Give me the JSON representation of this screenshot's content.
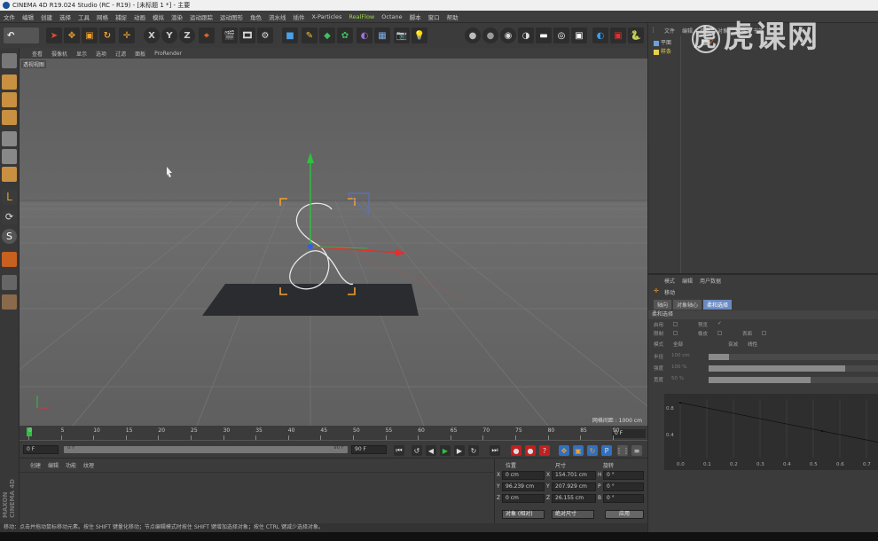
{
  "app": {
    "title": "CINEMA 4D R19.024 Studio (RC - R19) - [未标题 1 *] - 主要"
  },
  "menubar": [
    "文件",
    "编辑",
    "创建",
    "选择",
    "工具",
    "网格",
    "捕捉",
    "动画",
    "模拟",
    "渲染",
    "运动跟踪",
    "运动图形",
    "角色",
    "流水线",
    "插件",
    "X-Particles",
    "RealFlow",
    "Octane",
    "脚本",
    "窗口",
    "帮助"
  ],
  "menubar_accent_item": "RealFlow",
  "viewport": {
    "menu": [
      "查看",
      "摄像机",
      "显示",
      "选项",
      "过滤",
      "面板",
      "ProRender"
    ],
    "label": "透视视图",
    "grid_spacing": "网格间距 : 1000 cm"
  },
  "timeline": {
    "ticks": [
      "0",
      "5",
      "10",
      "15",
      "20",
      "25",
      "30",
      "35",
      "40",
      "45",
      "50",
      "55",
      "60",
      "65",
      "70",
      "75",
      "80",
      "85",
      "90"
    ],
    "current_frame": "0 F",
    "start_field": "0 F",
    "scroll_start": "0 F",
    "scroll_end": "90 F",
    "end_field": "90 F"
  },
  "material_panel": {
    "menu": [
      "创建",
      "编辑",
      "功能",
      "纹理"
    ]
  },
  "coordinates": {
    "headers": [
      "位置",
      "尺寸",
      "旋转"
    ],
    "rows": [
      {
        "axis": "X",
        "pos": "0 cm",
        "size_axis": "X",
        "size": "154.701 cm",
        "rot_axis": "H",
        "rot": "0 °"
      },
      {
        "axis": "Y",
        "pos": "96.239 cm",
        "size_axis": "Y",
        "size": "207.929 cm",
        "rot_axis": "P",
        "rot": "0 °"
      },
      {
        "axis": "Z",
        "pos": "0 cm",
        "size_axis": "Z",
        "size": "26.155 cm",
        "rot_axis": "B",
        "rot": "0 °"
      }
    ],
    "mode_dropdown": "对象 (相对)",
    "size_dropdown": "绝对尺寸",
    "apply_button": "应用"
  },
  "status": "移动：点击并拖动鼠标移动元素。按住 SHIFT 键量化移动；节点编辑模式时按住 SHIFT 键增加选择对象；按住 CTRL 键减少选择对象。",
  "object_manager": {
    "menu": [
      "文件",
      "编辑",
      "查看",
      "对象",
      "标签",
      "书签"
    ],
    "objects": [
      {
        "name": "平面",
        "color": "#c8c8c8"
      },
      {
        "name": "样条",
        "color": "#e8d24a"
      }
    ]
  },
  "attribute_manager": {
    "menu": [
      "模式",
      "编辑",
      "用户数据"
    ],
    "tool_name": "移动",
    "tabs": [
      "轴向",
      "对象轴心",
      "柔和选择"
    ],
    "active_tab": "柔和选择",
    "section": "柔和选择",
    "rows": [
      {
        "label": "启用",
        "value": ""
      },
      {
        "label": "预览",
        "value": "✓"
      },
      {
        "label": "限制",
        "value": ""
      },
      {
        "label": "橡皮",
        "value": ""
      },
      {
        "label": "表面",
        "value": ""
      },
      {
        "label": "模式",
        "value": "全部"
      },
      {
        "label": "衰减",
        "value": "线性"
      },
      {
        "label": "半径",
        "value": "100 cm"
      },
      {
        "label": "强度",
        "value": "100 %"
      },
      {
        "label": "宽度",
        "value": "50 %"
      }
    ],
    "graph_y_labels": [
      "0.8",
      "0.4"
    ],
    "graph_x_labels": [
      "0.0",
      "0.1",
      "0.2",
      "0.3",
      "0.4",
      "0.5",
      "0.6",
      "0.7"
    ],
    "falloff_curve": {
      "x": [
        0.0,
        0.5,
        1.0
      ],
      "y": [
        1.0,
        0.5,
        0.0
      ]
    }
  },
  "watermark": "虎课网",
  "colors": {
    "x_axis": "#e03030",
    "y_axis": "#30c040",
    "z_axis": "#3060e0",
    "bbox": "#f0a030",
    "accent": "#9dd34a"
  }
}
